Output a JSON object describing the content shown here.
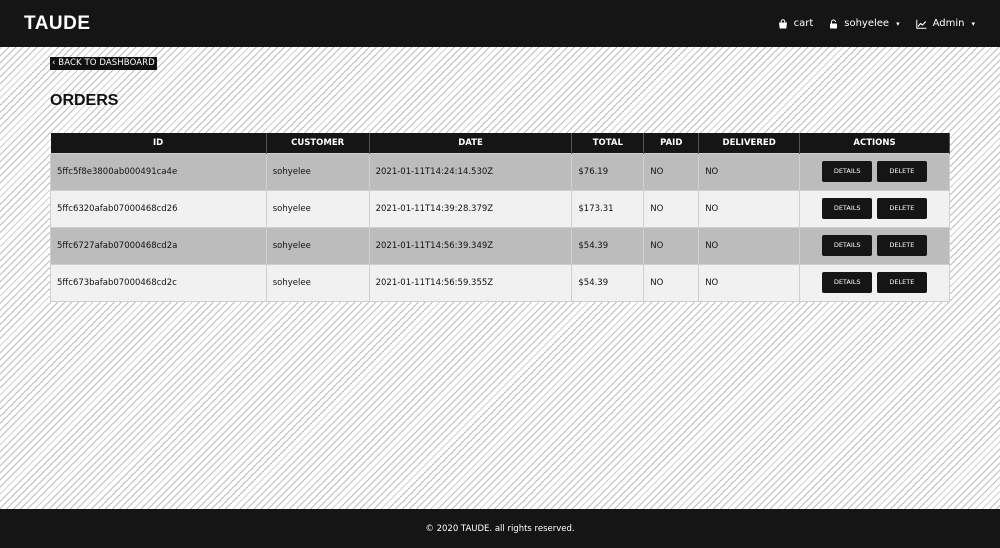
{
  "nav": {
    "brand": "TAUDE",
    "cart_label": "cart",
    "user_label": "sohyelee",
    "admin_label": "Admin",
    "caret": "▾"
  },
  "back_label": "‹ BACK TO DASHBOARD",
  "page_title": "ORDERS",
  "table": {
    "headers": [
      "ID",
      "CUSTOMER",
      "DATE",
      "TOTAL",
      "PAID",
      "DELIVERED",
      "ACTIONS"
    ],
    "rows": [
      {
        "id": "5ffc5f8e3800ab000491ca4e",
        "customer": "sohyelee",
        "date": "2021-01-11T14:24:14.530Z",
        "total": "$76.19",
        "paid": "NO",
        "delivered": "NO"
      },
      {
        "id": "5ffc6320afab07000468cd26",
        "customer": "sohyelee",
        "date": "2021-01-11T14:39:28.379Z",
        "total": "$173.31",
        "paid": "NO",
        "delivered": "NO"
      },
      {
        "id": "5ffc6727afab07000468cd2a",
        "customer": "sohyelee",
        "date": "2021-01-11T14:56:39.349Z",
        "total": "$54.39",
        "paid": "NO",
        "delivered": "NO"
      },
      {
        "id": "5ffc673bafab07000468cd2c",
        "customer": "sohyelee",
        "date": "2021-01-11T14:56:59.355Z",
        "total": "$54.39",
        "paid": "NO",
        "delivered": "NO"
      }
    ],
    "details_label": "DETAILS",
    "delete_label": "DELETE"
  },
  "footer_text": "© 2020 TAUDE. all rights reserved.",
  "colors": {
    "navbar": "#151515",
    "row_dark": "#bcbcbc",
    "row_light": "#f1f1f1",
    "button": "#151515"
  },
  "icons": [
    "shopping-bag-icon",
    "lock-icon",
    "chart-line-icon"
  ]
}
